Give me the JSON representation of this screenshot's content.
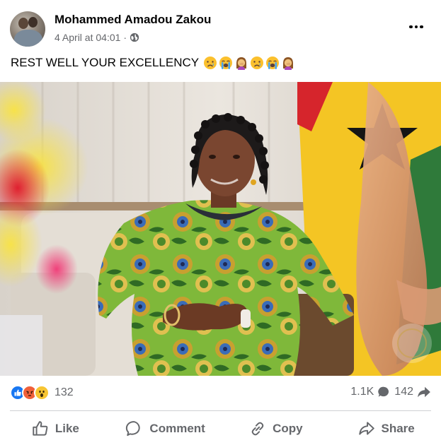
{
  "post": {
    "author": "Mohammed Amadou Zakou",
    "timestamp": "4 April at 04:01",
    "separator": "·",
    "privacy_icon": "globe-icon",
    "caption": "REST WELL YOUR EXCELLENCY",
    "caption_emojis": [
      "crying-face",
      "loudly-crying-face",
      "woman-facepalming",
      "crying-face",
      "loudly-crying-face",
      "woman-facepalming"
    ]
  },
  "reactions": {
    "types": [
      "like",
      "angry",
      "wow"
    ],
    "count": "132"
  },
  "stats": {
    "comments": "1.1K",
    "shares": "142"
  },
  "actions": {
    "like": "Like",
    "comment": "Comment",
    "copy": "Copy",
    "share": "Share"
  },
  "colors": {
    "like_blue": "#1877f2",
    "angry_orange": "#f0603a",
    "wow_yellow": "#f7c533",
    "secondary_text": "#65676b"
  }
}
